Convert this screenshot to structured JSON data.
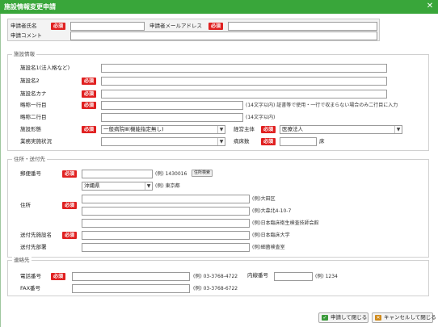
{
  "window": {
    "title": "施設情報変更申請",
    "close_glyph": "✕"
  },
  "required_label": "必須",
  "applicant": {
    "name_label": "申請者氏名",
    "email_label": "申請者メールアドレス",
    "comment_label": "申請コメント",
    "name_value": "",
    "email_value": "",
    "comment_value": ""
  },
  "facility": {
    "legend": "施設情報",
    "name_corp_label": "施設名1(法人格など)",
    "name2_label": "施設名2",
    "kana_label": "施設名カナ",
    "abbr1_label": "略称一行目",
    "abbr1_hint": "(14文字以内) 証書等で使用・一行で収まらない場合のみ二行目に入力",
    "abbr2_label": "略称二行目",
    "abbr2_hint": "(14文字以内)",
    "type_label": "施設形態",
    "type_value": "一般病院Ⅲ(機能指定無し)",
    "owner_label": "経営主体",
    "owner_value": "医療法人",
    "status_label": "業務実施状況",
    "status_value": "",
    "beds_label": "病床数",
    "beds_unit": "床"
  },
  "address": {
    "legend": "住所・送付先",
    "postal_label": "郵便番号",
    "postal_hint": "(例) 1430016",
    "postal_search_button": "住所検索",
    "prefecture_value": "沖縄県",
    "prefecture_hint": "(例) 東京都",
    "address_label": "住所",
    "addr1_hint": "(例)大田区",
    "addr2_hint": "(例)大森北4-10-7",
    "addr3_hint": "(例)日本臨床衛生検査技師会館",
    "dest_name_label": "送付先施設名",
    "dest_name_hint": "(例)日本臨床大学",
    "dest_dept_label": "送付先部署",
    "dest_dept_hint": "(例)細菌検査室"
  },
  "contact": {
    "legend": "連絡先",
    "phone_label": "電話番号",
    "phone_hint": "(例) 03-3768-4722",
    "ext_label": "内線番号",
    "ext_hint": "(例) 1234",
    "fax_label": "FAX番号",
    "fax_hint": "(例) 03-3768-6722"
  },
  "buttons": {
    "apply_close": "申請して閉じる",
    "cancel_close": "キャンセルして閉じる"
  },
  "colors": {
    "titlebar": "#39a63a",
    "required": "#e02020"
  }
}
